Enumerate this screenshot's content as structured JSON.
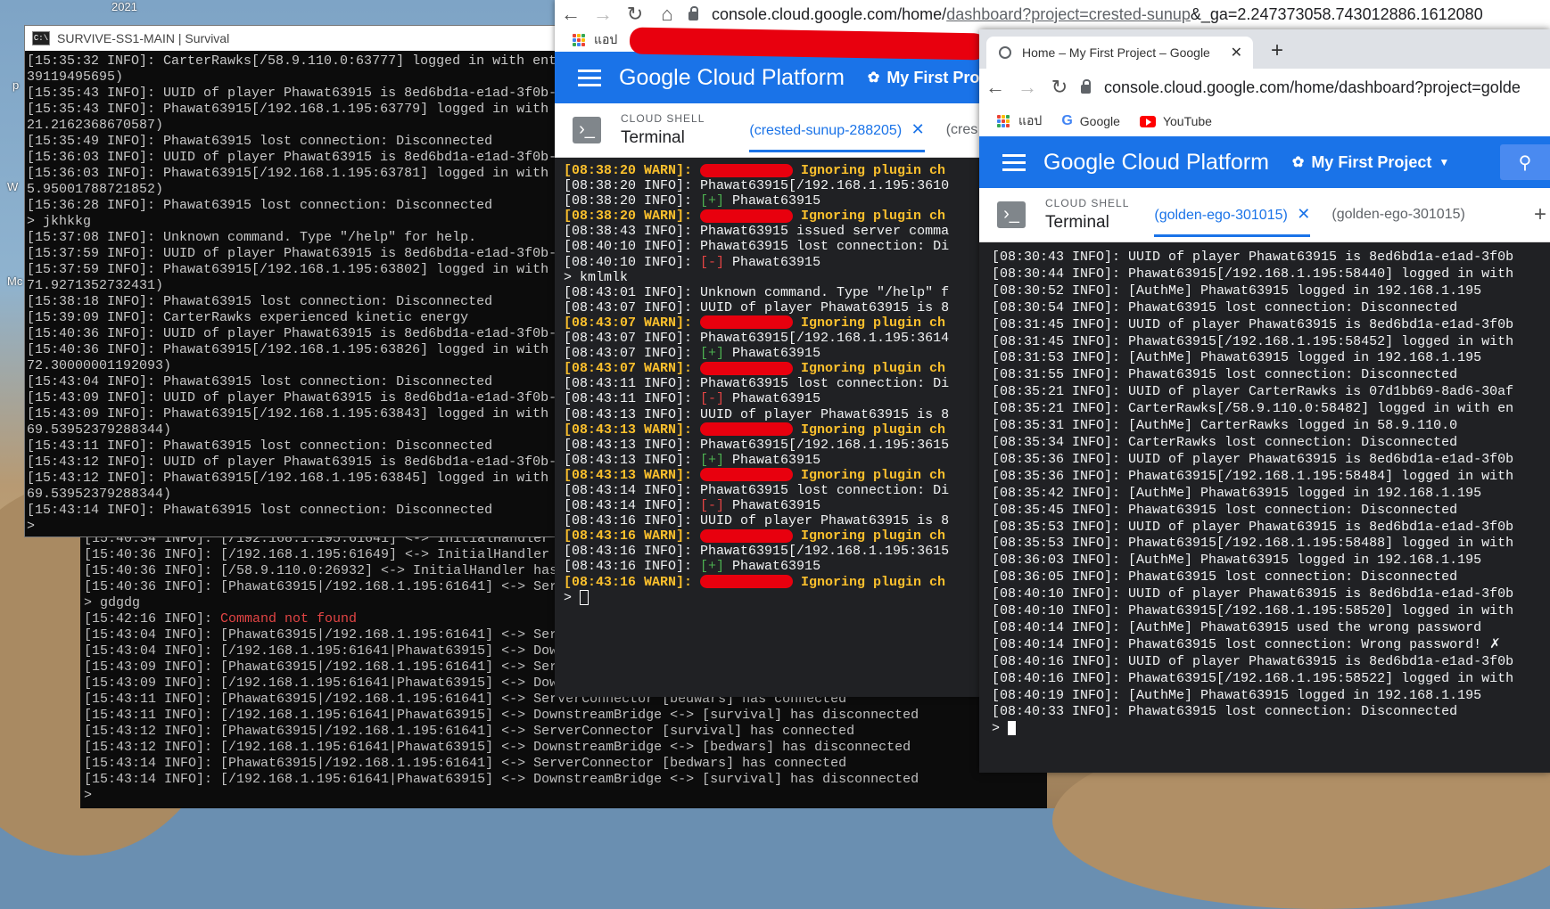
{
  "desktop": {
    "year_label": "2021",
    "side_labels": [
      "p",
      "W",
      "Mc"
    ]
  },
  "console_window": {
    "title": "SURVIVE-SS1-MAIN | Survival",
    "lines": [
      "[15:35:32 INFO]: CarterRawks[/58.9.110.0:63777] logged in with ent",
      "39119495695)",
      "[15:35:43 INFO]: UUID of player Phawat63915 is 8ed6bd1a-e1ad-3f0b-",
      "[15:35:43 INFO]: Phawat63915[/192.168.1.195:63779] logged in with",
      "21.2162368670587)",
      "[15:35:49 INFO]: Phawat63915 lost connection: Disconnected",
      "[15:36:03 INFO]: UUID of player Phawat63915 is 8ed6bd1a-e1ad-3f0b-",
      "[15:36:03 INFO]: Phawat63915[/192.168.1.195:63781] logged in with",
      "5.95001788721852)",
      "[15:36:28 INFO]: Phawat63915 lost connection: Disconnected",
      "> jkhkkg",
      "[15:37:08 INFO]: Unknown command. Type \"/help\" for help.",
      "[15:37:59 INFO]: UUID of player Phawat63915 is 8ed6bd1a-e1ad-3f0b-",
      "[15:37:59 INFO]: Phawat63915[/192.168.1.195:63802] logged in with",
      "71.9271352732431)",
      "[15:38:18 INFO]: Phawat63915 lost connection: Disconnected",
      "[15:39:09 INFO]: CarterRawks experienced kinetic energy",
      "[15:40:36 INFO]: UUID of player Phawat63915 is 8ed6bd1a-e1ad-3f0b-",
      "[15:40:36 INFO]: Phawat63915[/192.168.1.195:63826] logged in with",
      "72.30000001192093)",
      "[15:43:04 INFO]: Phawat63915 lost connection: Disconnected",
      "[15:43:09 INFO]: UUID of player Phawat63915 is 8ed6bd1a-e1ad-3f0b-",
      "[15:43:09 INFO]: Phawat63915[/192.168.1.195:63843] logged in with",
      "69.53952379288344)",
      "[15:43:11 INFO]: Phawat63915 lost connection: Disconnected",
      "[15:43:12 INFO]: UUID of player Phawat63915 is 8ed6bd1a-e1ad-3f0b-",
      "[15:43:12 INFO]: Phawat63915[/192.168.1.195:63845] logged in with",
      "69.53952379288344)",
      "[15:43:14 INFO]: Phawat63915 lost connection: Disconnected",
      ">"
    ]
  },
  "bungee_window": {
    "lines": [
      "[15:40:34 INFO]: [/192.168.1.195:61641] <-> InitialHandler",
      "[15:40:36 INFO]: [/192.168.1.195:61649] <-> InitialHandler",
      "[15:40:36 INFO]: [/58.9.110.0:26932] <-> InitialHandler has",
      "[15:40:36 INFO]: [Phawat63915|/192.168.1.195:61641] <-> Ser",
      "> gdgdg",
      "[15:42:16 INFO]: ",
      "[15:43:04 INFO]: [Phawat63915|/192.168.1.195:61641] <-> Ser",
      "[15:43:04 INFO]: [/192.168.1.195:61641|Phawat63915] <-> Dow",
      "[15:43:09 INFO]: [Phawat63915|/192.168.1.195:61641] <-> Ser",
      "[15:43:09 INFO]: [/192.168.1.195:61641|Phawat63915] <-> DownstreamBridge <-> [bedwars] has disconnected",
      "[15:43:11 INFO]: [Phawat63915|/192.168.1.195:61641] <-> ServerConnector [bedwars] has connected",
      "[15:43:11 INFO]: [/192.168.1.195:61641|Phawat63915] <-> DownstreamBridge <-> [survival] has disconnected",
      "[15:43:12 INFO]: [Phawat63915|/192.168.1.195:61641] <-> ServerConnector [survival] has connected",
      "[15:43:12 INFO]: [/192.168.1.195:61641|Phawat63915] <-> DownstreamBridge <-> [bedwars] has disconnected",
      "[15:43:14 INFO]: [Phawat63915|/192.168.1.195:61641] <-> ServerConnector [bedwars] has connected",
      "[15:43:14 INFO]: [/192.168.1.195:61641|Phawat63915] <-> DownstreamBridge <-> [survival] has disconnected",
      ">"
    ],
    "error_text": "Command not found"
  },
  "chrome1": {
    "url_prefix": "console.cloud.google.com/home/",
    "url_muted": "dashboard?project=crested-sunup",
    "url_suffix": "&_ga=2.247373058.743012886.1612080",
    "bookmark_apps": "แอป",
    "gcp_title": "Google Cloud Platform",
    "project_label": "My First Proje",
    "shell_small": "CLOUD SHELL",
    "shell_big": "Terminal",
    "shell_tab": "(crested-sunup-288205)",
    "shell_tab2": "(cres",
    "terminal": [
      {
        "t": "[08:38:20 WARN]: ",
        "r": "Ignoring plugin ch",
        "k": "warn"
      },
      {
        "t": "[08:38:20 INFO]: Phawat63915[/192.168.1.195:3610",
        "k": "info"
      },
      {
        "t": "[08:38:20 INFO]: ",
        "p": "[+]",
        "s": " Phawat63915",
        "k": "plus"
      },
      {
        "t": "[08:38:20 WARN]: ",
        "r": "Ignoring plugin ch",
        "k": "warn"
      },
      {
        "t": "[08:38:43 INFO]: Phawat63915 issued server comma",
        "k": "info"
      },
      {
        "t": "[08:40:10 INFO]: Phawat63915 lost connection: Di",
        "k": "info"
      },
      {
        "t": "[08:40:10 INFO]: ",
        "p": "[-]",
        "s": " Phawat63915",
        "k": "minus"
      },
      {
        "t": "> kmlmlk",
        "k": "info"
      },
      {
        "t": "[08:43:01 INFO]: Unknown command. Type \"/help\" f",
        "k": "info"
      },
      {
        "t": "[08:43:07 INFO]: UUID of player Phawat63915 is 8",
        "k": "info"
      },
      {
        "t": "[08:43:07 WARN]: ",
        "r": "Ignoring plugin ch",
        "k": "warn"
      },
      {
        "t": "[08:43:07 INFO]: Phawat63915[/192.168.1.195:3614",
        "k": "info"
      },
      {
        "t": "[08:43:07 INFO]: ",
        "p": "[+]",
        "s": " Phawat63915",
        "k": "plus"
      },
      {
        "t": "[08:43:07 WARN]: ",
        "r": "Ignoring plugin ch",
        "k": "warn"
      },
      {
        "t": "[08:43:11 INFO]: Phawat63915 lost connection: Di",
        "k": "info"
      },
      {
        "t": "[08:43:11 INFO]: ",
        "p": "[-]",
        "s": " Phawat63915",
        "k": "minus"
      },
      {
        "t": "[08:43:13 INFO]: UUID of player Phawat63915 is 8",
        "k": "info"
      },
      {
        "t": "[08:43:13 WARN]: ",
        "r": "Ignoring plugin ch",
        "k": "warn"
      },
      {
        "t": "[08:43:13 INFO]: Phawat63915[/192.168.1.195:3615",
        "k": "info"
      },
      {
        "t": "[08:43:13 INFO]: ",
        "p": "[+]",
        "s": " Phawat63915",
        "k": "plus"
      },
      {
        "t": "[08:43:13 WARN]: ",
        "r": "Ignoring plugin ch",
        "k": "warn"
      },
      {
        "t": "[08:43:14 INFO]: Phawat63915 lost connection: Di",
        "k": "info"
      },
      {
        "t": "[08:43:14 INFO]: ",
        "p": "[-]",
        "s": " Phawat63915",
        "k": "minus"
      },
      {
        "t": "[08:43:16 INFO]: UUID of player Phawat63915 is 8",
        "k": "info"
      },
      {
        "t": "[08:43:16 WARN]: ",
        "r": "Ignoring plugin ch",
        "k": "warn"
      },
      {
        "t": "[08:43:16 INFO]: Phawat63915[/192.168.1.195:3615",
        "k": "info"
      },
      {
        "t": "[08:43:16 INFO]: ",
        "p": "[+]",
        "s": " Phawat63915",
        "k": "plus"
      },
      {
        "t": "[08:43:16 WARN]: ",
        "r": "Ignoring plugin ch",
        "k": "warn"
      },
      {
        "t": "> ",
        "k": "prompt"
      }
    ]
  },
  "chrome2": {
    "tab_title": "Home – My First Project – Google",
    "url": "console.cloud.google.com/home/dashboard?project=golde",
    "bookmarks": [
      "แอป",
      "Google",
      "YouTube"
    ],
    "gcp_title": "Google Cloud Platform",
    "project_label": "My First Project",
    "shell_small": "CLOUD SHELL",
    "shell_big": "Terminal",
    "shell_tab": "(golden-ego-301015)",
    "shell_tab2": "(golden-ego-301015)",
    "terminal": [
      "[08:30:43 INFO]: UUID of player Phawat63915 is 8ed6bd1a-e1ad-3f0b",
      "[08:30:44 INFO]: Phawat63915[/192.168.1.195:58440] logged in with",
      "[08:30:52 INFO]: [AuthMe] Phawat63915 logged in 192.168.1.195",
      "[08:30:54 INFO]: Phawat63915 lost connection: Disconnected",
      "[08:31:45 INFO]: UUID of player Phawat63915 is 8ed6bd1a-e1ad-3f0b",
      "[08:31:45 INFO]: Phawat63915[/192.168.1.195:58452] logged in with",
      "[08:31:53 INFO]: [AuthMe] Phawat63915 logged in 192.168.1.195",
      "[08:31:55 INFO]: Phawat63915 lost connection: Disconnected",
      "[08:35:21 INFO]: UUID of player CarterRawks is 07d1bb69-8ad6-30af",
      "[08:35:21 INFO]: CarterRawks[/58.9.110.0:58482] logged in with en",
      "[08:35:31 INFO]: [AuthMe] CarterRawks logged in 58.9.110.0",
      "[08:35:34 INFO]: CarterRawks lost connection: Disconnected",
      "[08:35:36 INFO]: UUID of player Phawat63915 is 8ed6bd1a-e1ad-3f0b",
      "[08:35:36 INFO]: Phawat63915[/192.168.1.195:58484] logged in with",
      "[08:35:42 INFO]: [AuthMe] Phawat63915 logged in 192.168.1.195",
      "[08:35:45 INFO]: Phawat63915 lost connection: Disconnected",
      "[08:35:53 INFO]: UUID of player Phawat63915 is 8ed6bd1a-e1ad-3f0b",
      "[08:35:53 INFO]: Phawat63915[/192.168.1.195:58488] logged in with",
      "[08:36:03 INFO]: [AuthMe] Phawat63915 logged in 192.168.1.195",
      "[08:36:05 INFO]: Phawat63915 lost connection: Disconnected",
      "[08:40:10 INFO]: UUID of player Phawat63915 is 8ed6bd1a-e1ad-3f0b",
      "[08:40:10 INFO]: Phawat63915[/192.168.1.195:58520] logged in with",
      "[08:40:14 INFO]: [AuthMe] Phawat63915 used the wrong password",
      "[08:40:14 INFO]: Phawat63915 lost connection: Wrong password! ✗",
      "[08:40:16 INFO]: UUID of player Phawat63915 is 8ed6bd1a-e1ad-3f0b",
      "[08:40:16 INFO]: Phawat63915[/192.168.1.195:58522] logged in with",
      "[08:40:19 INFO]: [AuthMe] Phawat63915 logged in 192.168.1.195",
      "[08:40:33 INFO]: Phawat63915 lost connection: Disconnected",
      "> "
    ]
  },
  "colors": {
    "gcp_blue": "#1a73e8",
    "terminal_bg": "#202124",
    "warn": "#fbc02d",
    "plus": "#4caf50",
    "minus_error": "#e24444",
    "redaction": "#e8000e"
  }
}
